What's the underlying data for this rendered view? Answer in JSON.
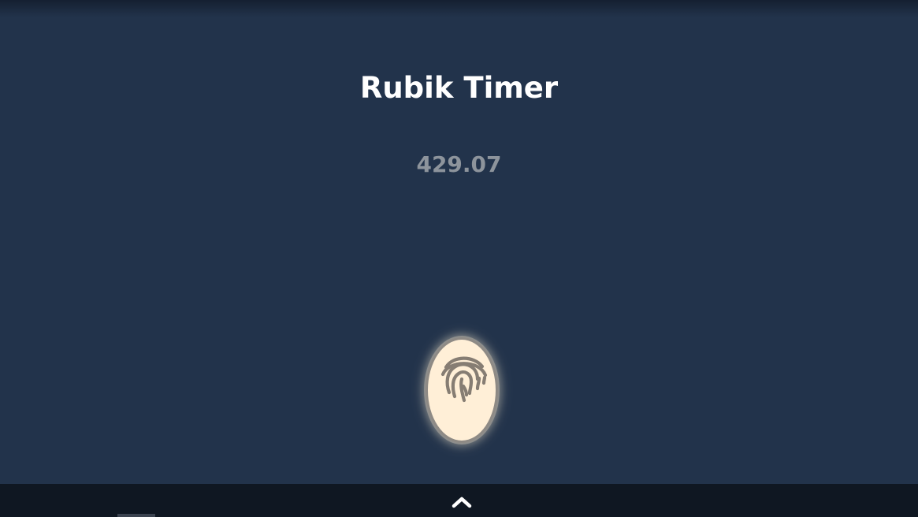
{
  "app": {
    "title": "Rubik Timer"
  },
  "timer": {
    "display": "429.07"
  },
  "controls": {
    "fingerprint_icon": "fingerprint-icon",
    "expand_icon": "chevron-up-icon"
  },
  "colors": {
    "background": "#22334b",
    "title_text": "#ffffff",
    "timer_text": "#8d949c",
    "button_fill": "#ffefd7",
    "icon_stroke": "#867d73",
    "bottom_bar": "#0f1722"
  }
}
